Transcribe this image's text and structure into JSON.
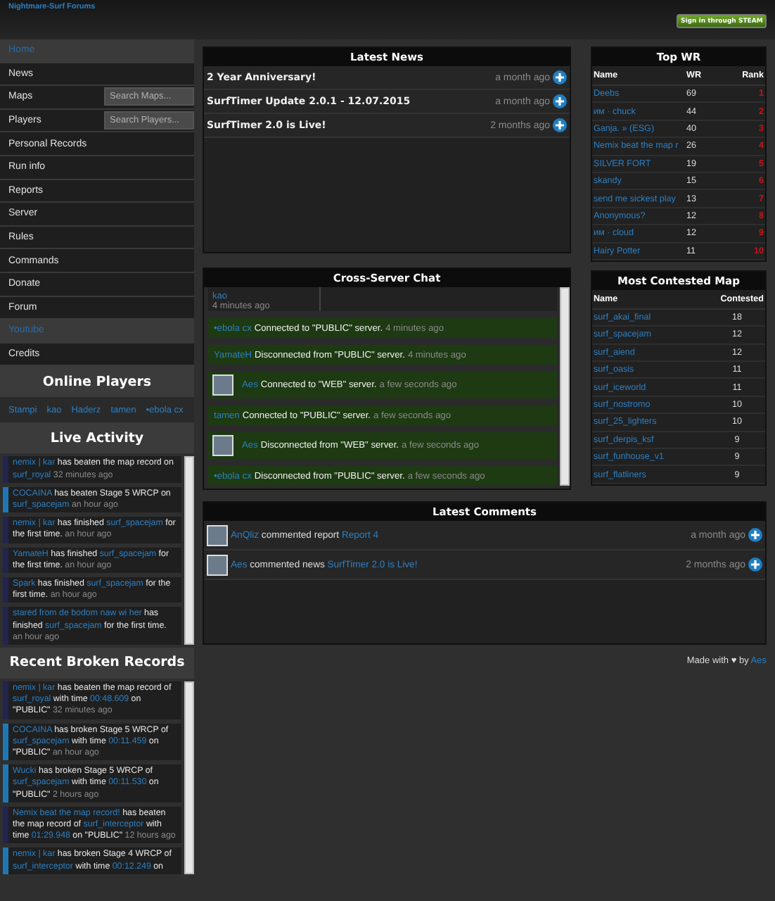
{
  "header": {
    "site_title": "Nightmare-Surf Forums",
    "steam_button": "Sign in through STEAM"
  },
  "nav": [
    {
      "label": "Home",
      "selected": true
    },
    {
      "label": "News",
      "selected": false
    },
    {
      "label": "Maps",
      "selected": false,
      "search_placeholder": "Search Maps..."
    },
    {
      "label": "Players",
      "selected": false,
      "search_placeholder": "Search Players..."
    },
    {
      "label": "Personal Records",
      "selected": false
    },
    {
      "label": "Run info",
      "selected": false
    },
    {
      "label": "Reports",
      "selected": false
    },
    {
      "label": "Server",
      "selected": false
    },
    {
      "label": "Rules",
      "selected": false
    },
    {
      "label": "Commands",
      "selected": false
    },
    {
      "label": "Donate",
      "selected": false
    },
    {
      "label": "Forum",
      "selected": false
    },
    {
      "label": "Youtube",
      "selected": true
    },
    {
      "label": "Credits",
      "selected": false
    }
  ],
  "online_players": {
    "title": "Online Players",
    "players": [
      "Stampi",
      "kao",
      "Haderz",
      "tamen",
      "•ebola cx"
    ]
  },
  "live_activity": {
    "title": "Live Activity",
    "items": [
      {
        "color": "#23234f",
        "parts": [
          {
            "kind": "link",
            "text": "nemix | kar"
          },
          {
            "kind": "text",
            "text": " has beaten the map record on "
          },
          {
            "kind": "link",
            "text": "surf_royal"
          },
          {
            "kind": "time",
            "text": " 32 minutes ago"
          }
        ]
      },
      {
        "color": "#1f78b4",
        "parts": [
          {
            "kind": "link",
            "text": "COCAINA"
          },
          {
            "kind": "text",
            "text": " has beaten Stage 5 WRCP on "
          },
          {
            "kind": "link",
            "text": "surf_spacejam"
          },
          {
            "kind": "time",
            "text": " an hour ago"
          }
        ]
      },
      {
        "color": "#23234f",
        "parts": [
          {
            "kind": "link",
            "text": "nemix | kar"
          },
          {
            "kind": "text",
            "text": " has finished "
          },
          {
            "kind": "link",
            "text": "surf_spacejam"
          },
          {
            "kind": "text",
            "text": " for the first time."
          },
          {
            "kind": "time",
            "text": " an hour ago"
          }
        ]
      },
      {
        "color": "#23234f",
        "parts": [
          {
            "kind": "link",
            "text": "YamateH"
          },
          {
            "kind": "text",
            "text": " has finished "
          },
          {
            "kind": "link",
            "text": "surf_spacejam"
          },
          {
            "kind": "text",
            "text": " for the first time."
          },
          {
            "kind": "time",
            "text": " an hour ago"
          }
        ]
      },
      {
        "color": "#23234f",
        "parts": [
          {
            "kind": "link",
            "text": "Spark"
          },
          {
            "kind": "text",
            "text": " has finished "
          },
          {
            "kind": "link",
            "text": "surf_spacejam"
          },
          {
            "kind": "text",
            "text": " for the first time."
          },
          {
            "kind": "time",
            "text": " an hour ago"
          }
        ]
      },
      {
        "color": "#23234f",
        "parts": [
          {
            "kind": "link",
            "text": "stared from de bodom naw wi her"
          },
          {
            "kind": "text",
            "text": " has finished "
          },
          {
            "kind": "link",
            "text": "surf_spacejam"
          },
          {
            "kind": "text",
            "text": " for the first time."
          },
          {
            "kind": "time",
            "text": " an hour ago"
          }
        ]
      }
    ]
  },
  "broken_records": {
    "title": "Recent Broken Records",
    "items": [
      {
        "color": "#23234f",
        "parts": [
          {
            "kind": "link",
            "text": "nemix | kar"
          },
          {
            "kind": "text",
            "text": " has beaten the map record of "
          },
          {
            "kind": "link",
            "text": "surf_royal"
          },
          {
            "kind": "text",
            "text": " with time "
          },
          {
            "kind": "link",
            "text": "00:48.609"
          },
          {
            "kind": "text",
            "text": " on \"PUBLIC\""
          },
          {
            "kind": "time",
            "text": " 32 minutes ago"
          }
        ]
      },
      {
        "color": "#1f78b4",
        "parts": [
          {
            "kind": "link",
            "text": "COCAINA"
          },
          {
            "kind": "text",
            "text": " has broken Stage 5 WRCP of "
          },
          {
            "kind": "link",
            "text": "surf_spacejam"
          },
          {
            "kind": "text",
            "text": " with time "
          },
          {
            "kind": "link",
            "text": "00:11.459"
          },
          {
            "kind": "text",
            "text": " on \"PUBLIC\""
          },
          {
            "kind": "time",
            "text": " an hour ago"
          }
        ]
      },
      {
        "color": "#1f78b4",
        "parts": [
          {
            "kind": "link",
            "text": "Wucki"
          },
          {
            "kind": "text",
            "text": " has broken Stage 5 WRCP of "
          },
          {
            "kind": "link",
            "text": "surf_spacejam"
          },
          {
            "kind": "text",
            "text": " with time "
          },
          {
            "kind": "link",
            "text": "00:11.530"
          },
          {
            "kind": "text",
            "text": " on \"PUBLIC\""
          },
          {
            "kind": "time",
            "text": " 2 hours ago"
          }
        ]
      },
      {
        "color": "#23234f",
        "parts": [
          {
            "kind": "link",
            "text": "Nemix beat the map record!"
          },
          {
            "kind": "text",
            "text": " has beaten the map record of "
          },
          {
            "kind": "link",
            "text": "surf_interceptor"
          },
          {
            "kind": "text",
            "text": " with time "
          },
          {
            "kind": "link",
            "text": "01:29.948"
          },
          {
            "kind": "text",
            "text": " on \"PUBLIC\""
          },
          {
            "kind": "time",
            "text": " 12 hours ago"
          }
        ]
      },
      {
        "color": "#1f78b4",
        "parts": [
          {
            "kind": "link",
            "text": "nemix | kar"
          },
          {
            "kind": "text",
            "text": " has broken Stage 4 WRCP of "
          },
          {
            "kind": "link",
            "text": "surf_interceptor"
          },
          {
            "kind": "text",
            "text": " with time "
          },
          {
            "kind": "link",
            "text": "00:12.249"
          },
          {
            "kind": "text",
            "text": " on"
          }
        ]
      }
    ]
  },
  "latest_news": {
    "title": "Latest News",
    "items": [
      {
        "title": "2 Year Anniversary!",
        "time": "a month ago"
      },
      {
        "title": "SurfTimer Update 2.0.1 - 12.07.2015",
        "time": "a month ago"
      },
      {
        "title": "SurfTimer 2.0 is Live!",
        "time": "2 months ago"
      }
    ]
  },
  "chat": {
    "title": "Cross-Server Chat",
    "rows": [
      {
        "kind": "message",
        "name": "kao",
        "time": "4 minutes ago"
      },
      {
        "kind": "event",
        "avatar": false,
        "name": "•ebola cx",
        "text": " Connected to \"PUBLIC\" server.",
        "time": " 4 minutes ago"
      },
      {
        "kind": "event",
        "avatar": false,
        "name": "YamateH",
        "text": " Disconnected from \"PUBLIC\" server.",
        "time": " 4 minutes ago"
      },
      {
        "kind": "event",
        "avatar": true,
        "name": "Aes",
        "text": " Connected to \"WEB\" server.",
        "time": " a few seconds ago"
      },
      {
        "kind": "event",
        "avatar": false,
        "name": "tamen",
        "text": " Connected to \"PUBLIC\" server.",
        "time": " a few seconds ago"
      },
      {
        "kind": "event",
        "avatar": true,
        "name": "Aes",
        "text": " Disconnected from \"WEB\" server.",
        "time": " a few seconds ago"
      },
      {
        "kind": "event",
        "avatar": false,
        "name": "•ebola cx",
        "text": " Disconnected from \"PUBLIC\" server.",
        "time": " a few seconds ago"
      }
    ]
  },
  "top_wr": {
    "title": "Top WR",
    "columns": [
      "Name",
      "WR",
      "Rank"
    ],
    "rows": [
      [
        "Deebs",
        "69",
        "1"
      ],
      [
        "им · chuck",
        "44",
        "2"
      ],
      [
        "Ganja. » (ESG)",
        "40",
        "3"
      ],
      [
        "Nemix beat the map r",
        "26",
        "4"
      ],
      [
        "SILVER FORT",
        "19",
        "5"
      ],
      [
        "skandy",
        "15",
        "6"
      ],
      [
        "send me sickest play",
        "13",
        "7"
      ],
      [
        "Anonymous?",
        "12",
        "8"
      ],
      [
        "им · cloud",
        "12",
        "9"
      ],
      [
        "Hairy Potter",
        "11",
        "10"
      ]
    ]
  },
  "most_contested": {
    "title": "Most Contested Map",
    "columns": [
      "Name",
      "Contested"
    ],
    "rows": [
      [
        "surf_akai_final",
        "18"
      ],
      [
        "surf_spacejam",
        "12"
      ],
      [
        "surf_aiend",
        "12"
      ],
      [
        "surf_oasis",
        "11"
      ],
      [
        "surf_iceworld",
        "11"
      ],
      [
        "surf_nostromo",
        "10"
      ],
      [
        "surf_25_lighters",
        "10"
      ],
      [
        "surf_derpis_ksf",
        "9"
      ],
      [
        "surf_funhouse_v1",
        "9"
      ],
      [
        "surf_flatliners",
        "9"
      ]
    ]
  },
  "latest_comments": {
    "title": "Latest Comments",
    "items": [
      {
        "parts": [
          {
            "kind": "link",
            "text": "AnQliz"
          },
          {
            "kind": "text",
            "text": " commented report "
          },
          {
            "kind": "link",
            "text": "Report 4"
          }
        ],
        "time": "a month ago"
      },
      {
        "parts": [
          {
            "kind": "link",
            "text": "Aes"
          },
          {
            "kind": "text",
            "text": " commented news "
          },
          {
            "kind": "link",
            "text": "SurfTimer 2.0 is Live!"
          }
        ],
        "time": "2 months ago"
      }
    ]
  },
  "footer": {
    "parts": [
      {
        "kind": "text",
        "text": "Made with "
      },
      {
        "kind": "text",
        "text": "♥"
      },
      {
        "kind": "text",
        "text": " by "
      },
      {
        "kind": "link",
        "text": "Aes"
      }
    ]
  }
}
